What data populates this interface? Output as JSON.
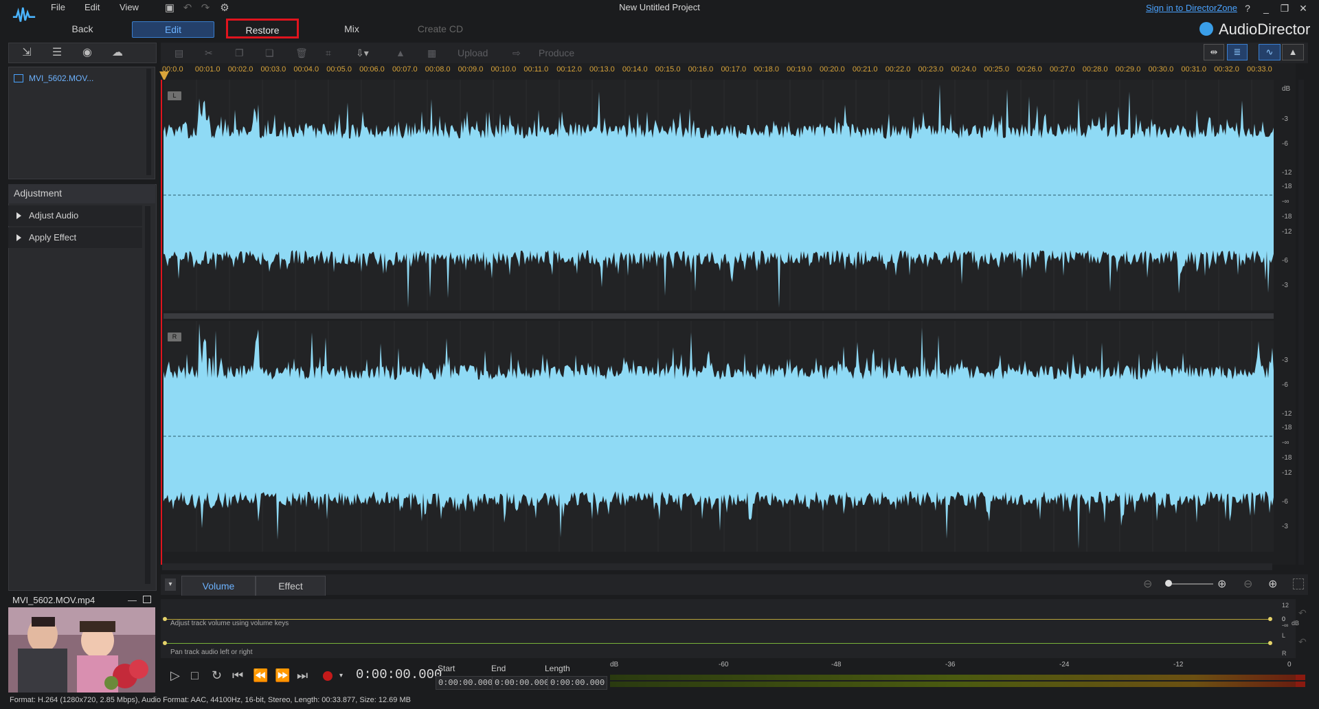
{
  "menu": {
    "file": "File",
    "edit": "Edit",
    "view": "View"
  },
  "window": {
    "title": "New Untitled Project",
    "signin": "Sign in to DirectorZone",
    "help": "?",
    "minimize": "_",
    "restore": "❐",
    "close": "✕"
  },
  "modes": {
    "back": "Back",
    "edit": "Edit",
    "restore": "Restore",
    "mix": "Mix",
    "create_cd": "Create CD"
  },
  "brand": "AudioDirector",
  "library": {
    "items": [
      {
        "label": "MVI_5602.MOV..."
      }
    ]
  },
  "adjustment": {
    "title": "Adjustment",
    "items": [
      {
        "label": "Adjust Audio"
      },
      {
        "label": "Apply Effect"
      }
    ]
  },
  "preview": {
    "title": "MVI_5602.MOV.mp4"
  },
  "toolbar": {
    "upload": "Upload",
    "produce": "Produce"
  },
  "ruler": {
    "ticks": [
      "00:0.0",
      "00:01.0",
      "00:02.0",
      "00:03.0",
      "00:04.0",
      "00:05.0",
      "00:06.0",
      "00:07.0",
      "00:08.0",
      "00:09.0",
      "00:10.0",
      "00:11.0",
      "00:12.0",
      "00:13.0",
      "00:14.0",
      "00:15.0",
      "00:16.0",
      "00:17.0",
      "00:18.0",
      "00:19.0",
      "00:20.0",
      "00:21.0",
      "00:22.0",
      "00:23.0",
      "00:24.0",
      "00:25.0",
      "00:26.0",
      "00:27.0",
      "00:28.0",
      "00:29.0",
      "00:30.0",
      "00:31.0",
      "00:32.0",
      "00:33.0"
    ]
  },
  "channels": {
    "left": "L",
    "right": "R"
  },
  "db_scale": {
    "unit": "dB",
    "labels": [
      "-3",
      "-6",
      "-12",
      "-18",
      "-∞",
      "-18",
      "-12",
      "-6",
      "-3"
    ]
  },
  "bottom_tabs": {
    "volume": "Volume",
    "effect": "Effect"
  },
  "lanes": {
    "volume_hint": "Adjust track volume using volume keys",
    "pan_hint": "Pan track audio left or right",
    "vol_top": "12",
    "vol_mid": "0",
    "vol_bot": "-∞",
    "vol_unit": "dB",
    "pan_l": "L",
    "pan_r": "R"
  },
  "transport": {
    "timecode": "0:00:00.000",
    "start_label": "Start",
    "end_label": "End",
    "length_label": "Length",
    "start": "0:00:00.000",
    "end": "0:00:00.000",
    "length": "0:00:00.000"
  },
  "meter": {
    "labels": [
      "dB",
      "-60",
      "-48",
      "-36",
      "-24",
      "-12",
      "0"
    ]
  },
  "status": "Format: H.264 (1280x720, 2.85 Mbps), Audio Format: AAC, 44100Hz, 16-bit, Stereo, Length: 00:33.877, Size: 12.69 MB",
  "colors": {
    "wave": "#8fdaf5",
    "accent": "#3a9ee8",
    "highlight": "#e0141e",
    "ruler": "#d9a43a"
  }
}
